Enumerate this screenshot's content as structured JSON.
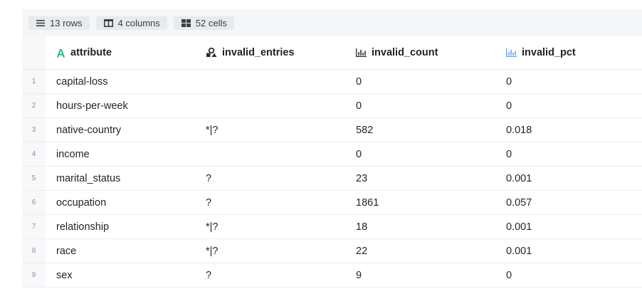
{
  "stats": {
    "rows": "13 rows",
    "columns": "4 columns",
    "cells": "52 cells"
  },
  "columns": [
    {
      "name": "attribute",
      "icon": "text-type-icon"
    },
    {
      "name": "invalid_entries",
      "icon": "mixed-type-icon"
    },
    {
      "name": "invalid_count",
      "icon": "bar-chart-icon"
    },
    {
      "name": "invalid_pct",
      "icon": "bar-chart-icon"
    }
  ],
  "rows": [
    {
      "index": "1",
      "attribute": "capital-loss",
      "invalid_entries": "",
      "invalid_count": "0",
      "invalid_pct": "0"
    },
    {
      "index": "2",
      "attribute": "hours-per-week",
      "invalid_entries": "",
      "invalid_count": "0",
      "invalid_pct": "0"
    },
    {
      "index": "3",
      "attribute": "native-country",
      "invalid_entries": "*|?",
      "invalid_count": "582",
      "invalid_pct": "0.018"
    },
    {
      "index": "4",
      "attribute": "income",
      "invalid_entries": "",
      "invalid_count": "0",
      "invalid_pct": "0"
    },
    {
      "index": "5",
      "attribute": "marital_status",
      "invalid_entries": "?",
      "invalid_count": "23",
      "invalid_pct": "0.001"
    },
    {
      "index": "6",
      "attribute": "occupation",
      "invalid_entries": "?",
      "invalid_count": "1861",
      "invalid_pct": "0.057"
    },
    {
      "index": "7",
      "attribute": "relationship",
      "invalid_entries": "*|?",
      "invalid_count": "18",
      "invalid_pct": "0.001"
    },
    {
      "index": "8",
      "attribute": "race",
      "invalid_entries": "*|?",
      "invalid_count": "22",
      "invalid_pct": "0.001"
    },
    {
      "index": "9",
      "attribute": "sex",
      "invalid_entries": "?",
      "invalid_count": "9",
      "invalid_pct": "0"
    }
  ],
  "colors": {
    "text_type_icon": "#22b573",
    "mixed_type_icon": "#2a2f35",
    "bar_icon_dark": "#2a2f35",
    "bar_icon_light": "#6aa3e6"
  }
}
